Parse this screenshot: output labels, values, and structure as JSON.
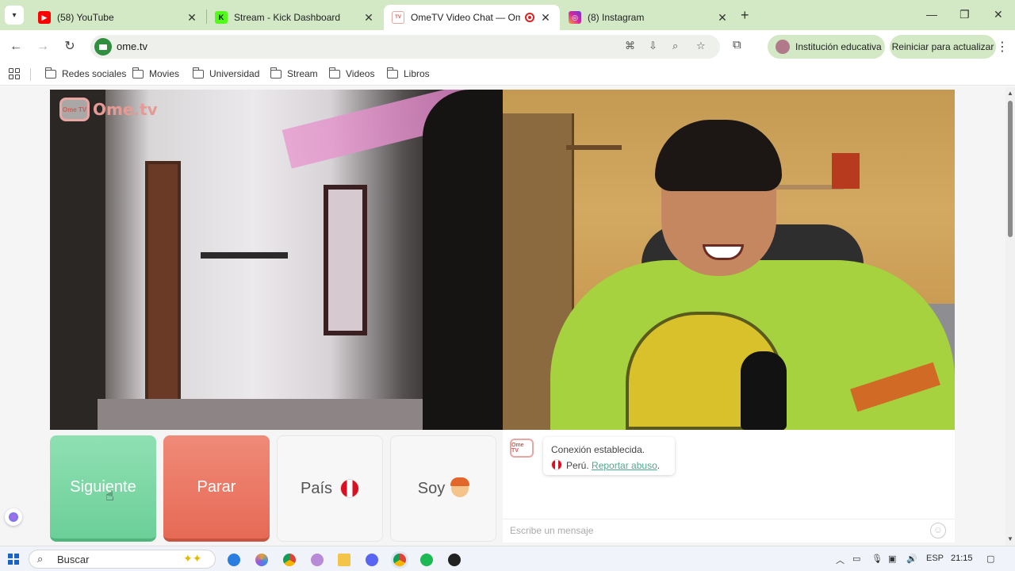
{
  "tabs": [
    {
      "title": "(58) YouTube",
      "favicon": "youtube-icon",
      "color": "#ff0000"
    },
    {
      "title": "Stream - Kick Dashboard",
      "favicon": "kick-icon",
      "color": "#53fc18"
    },
    {
      "title": "OmeTV Video Chat — Ome",
      "favicon": "ometv-icon",
      "color": "#e8a7a3",
      "active": true
    },
    {
      "title": "(8) Instagram",
      "favicon": "instagram-icon",
      "color": "#d6249f"
    }
  ],
  "address": {
    "url": "ome.tv"
  },
  "profile": {
    "label": "Institución educativa"
  },
  "restart": {
    "label": "Reiniciar para actualizar"
  },
  "bookmarks": [
    "Redes sociales",
    "Movies",
    "Universidad",
    "Stream",
    "Videos",
    "Libros"
  ],
  "brand": {
    "logo_tv": "Ome TV",
    "logo_text": "Ome.tv"
  },
  "controls": {
    "next_label": "Siguiente",
    "stop_label": "Parar",
    "country_label": "País",
    "me_label": "Soy"
  },
  "chat": {
    "system_line1": "Conexión establecida.",
    "country": "Perú.",
    "report_link": "Reportar abuso",
    "report_suffix": ".",
    "input_placeholder": "Escribe un mensaje"
  },
  "taskbar": {
    "search_placeholder": "Buscar",
    "language": "ESP",
    "time": "21:15"
  },
  "colors": {
    "next_button": "#6ccf98",
    "stop_button": "#e66a56",
    "tabstrip": "#d3e9c6",
    "link": "#4fa88a"
  }
}
